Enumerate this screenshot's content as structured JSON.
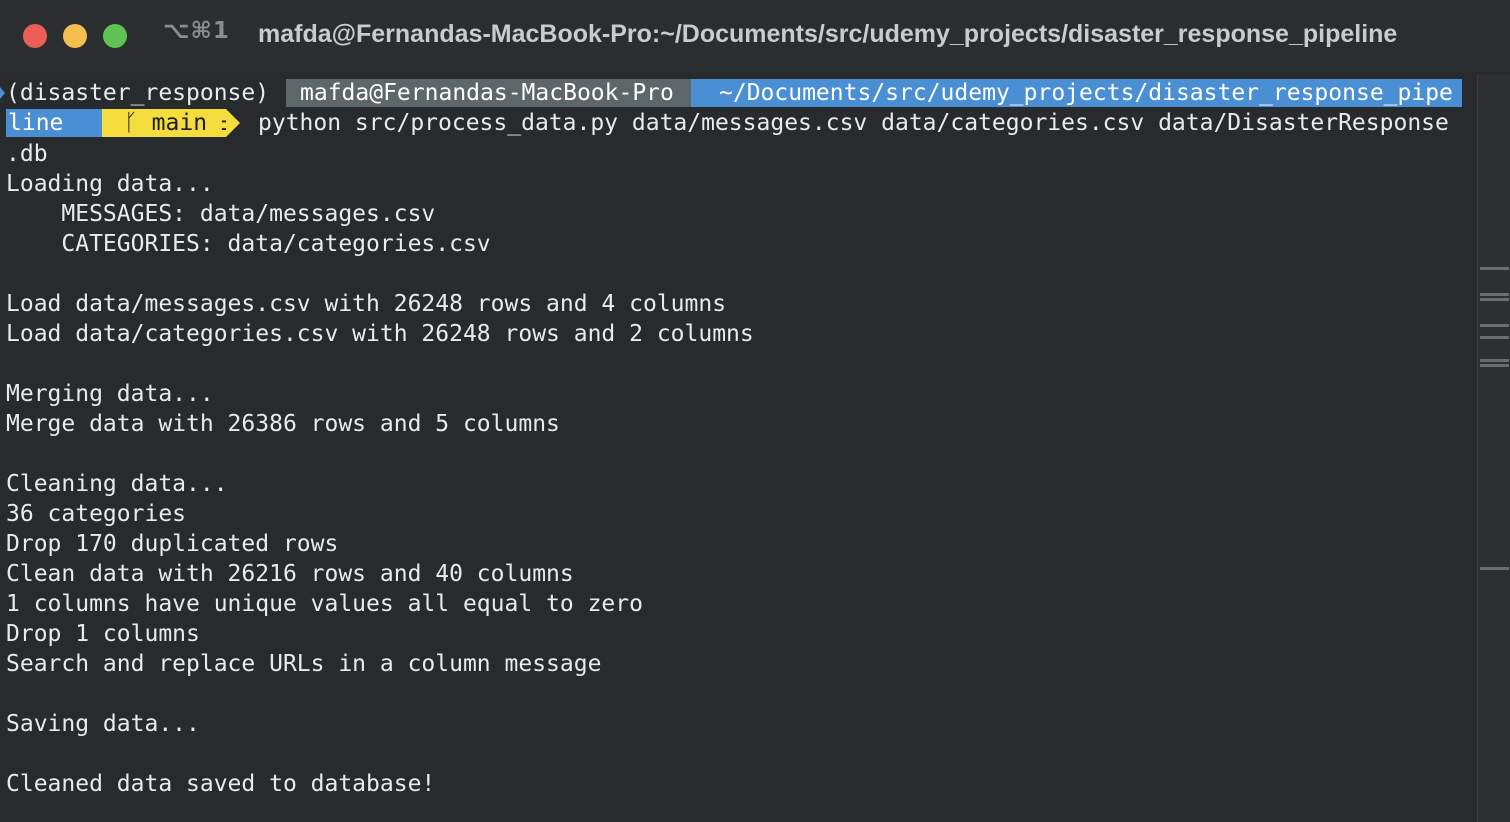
{
  "window": {
    "shortcut": "⌥⌘1",
    "title": "mafda@Fernandas-MacBook-Pro:~/Documents/src/udemy_projects/disaster_response_pipeline",
    "traffic_lights": {
      "close": "#ec5f56",
      "minimize": "#f4bf4f",
      "zoom": "#5fc454"
    }
  },
  "prompt": {
    "venv": "(disaster_response)",
    "user_host": "mafda@Fernandas-MacBook-Pro",
    "path_part1": "~/Documents/src/udemy_projects/disaster_response_pipe",
    "path_part2": "line",
    "git_branch": "ᚴ main ±",
    "command": "python src/process_data.py data/messages.csv data/categories.csv data/DisasterResponse",
    "command_wrap": ".db",
    "colors": {
      "user_segment": "#5d6668",
      "path_segment": "#4a8fd4",
      "git_segment": "#f4dd3c"
    }
  },
  "output": [
    "Loading data...",
    "    MESSAGES: data/messages.csv",
    "    CATEGORIES: data/categories.csv",
    "",
    "Load data/messages.csv with 26248 rows and 4 columns",
    "Load data/categories.csv with 26248 rows and 2 columns",
    "",
    "Merging data...",
    "Merge data with 26386 rows and 5 columns",
    "",
    "Cleaning data...",
    "36 categories",
    "Drop 170 duplicated rows",
    "Clean data with 26216 rows and 40 columns",
    "1 columns have unique values all equal to zero",
    "Drop 1 columns",
    "Search and replace URLs in a column message",
    "",
    "Saving data...",
    "",
    "Cleaned data saved to database!"
  ]
}
